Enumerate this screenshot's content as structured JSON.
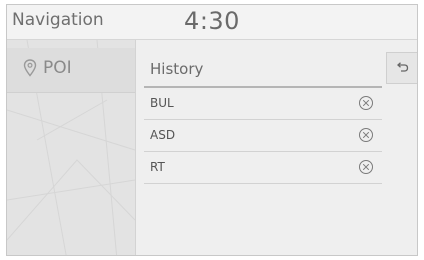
{
  "header": {
    "title": "Navigation",
    "clock": "4:30"
  },
  "sidebar": {
    "poi_label": "POI",
    "poi_icon": "map-pin-icon"
  },
  "content": {
    "section_title": "History",
    "back_icon": "back-arrow-icon",
    "history_items": [
      {
        "label": "BUL",
        "delete_icon": "circle-x-icon"
      },
      {
        "label": "ASD",
        "delete_icon": "circle-x-icon"
      },
      {
        "label": "RT",
        "delete_icon": "circle-x-icon"
      }
    ]
  },
  "colors": {
    "background": "#e9e9e9",
    "text": "#6a6a6a",
    "divider": "#b5b5b5"
  }
}
